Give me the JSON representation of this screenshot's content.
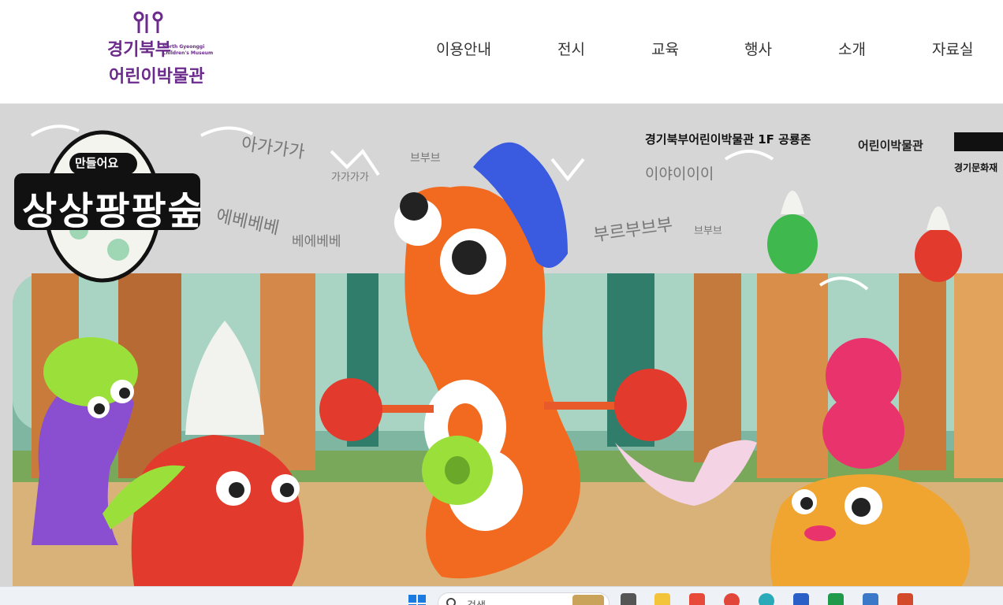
{
  "logo": {
    "name_ko_line1": "경기북부",
    "name_ko_line2": "어린이박물관",
    "name_en_line1": "North Gyeonggi",
    "name_en_line2": "Children's Museum",
    "color": "#6b2a8c"
  },
  "nav": {
    "items": [
      {
        "label": "이용안내"
      },
      {
        "label": "전시"
      },
      {
        "label": "교육"
      },
      {
        "label": "행사"
      },
      {
        "label": "소개"
      },
      {
        "label": "자료실"
      }
    ]
  },
  "banner": {
    "badge": "만들어요",
    "title": "상상팡팡숲",
    "location": "경기북부어린이박물관 1F 공룡존",
    "partner_logo_text": "경기문화재",
    "sound_words": [
      "아가가가",
      "가가가가",
      "브부브",
      "에베베베",
      "베에베베",
      "이야이이이",
      "부르부브부",
      "브부브"
    ],
    "colors": {
      "background": "#d6d6d6",
      "orange_character": "#f26a1f",
      "purple_character": "#8a4fd0",
      "red_character": "#e23a2c",
      "yellow_character": "#f0a531",
      "green": "#9be03a",
      "pink": "#e8336d",
      "blue": "#3a5ae0"
    }
  },
  "taskbar": {
    "search_placeholder": "검색",
    "icons": [
      "windows-start-icon",
      "search-icon",
      "task-view-icon",
      "file-explorer-icon",
      "app-icon",
      "chrome-icon",
      "edge-icon",
      "word-icon",
      "app-green-icon",
      "app-blue-icon",
      "powerpoint-icon"
    ]
  }
}
